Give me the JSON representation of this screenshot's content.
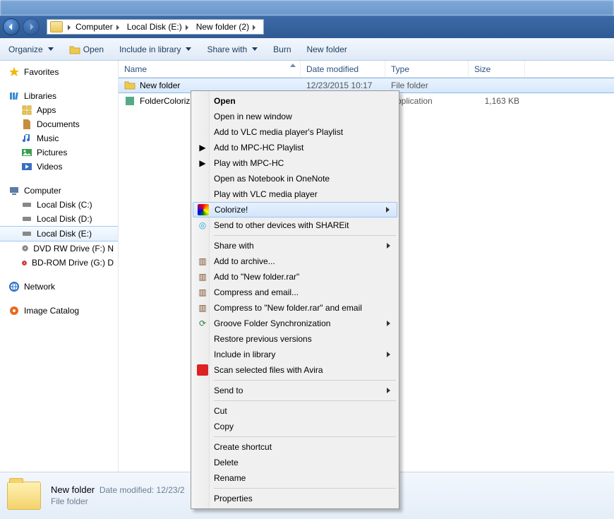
{
  "breadcrumb": {
    "parts": [
      "Computer",
      "Local Disk (E:)",
      "New folder (2)"
    ]
  },
  "toolbar": {
    "organize": "Organize",
    "open": "Open",
    "include": "Include in library",
    "share": "Share with",
    "burn": "Burn",
    "newfolder": "New folder"
  },
  "nav": {
    "favorites": "Favorites",
    "libraries": "Libraries",
    "apps": "Apps",
    "documents": "Documents",
    "music": "Music",
    "pictures": "Pictures",
    "videos": "Videos",
    "computer": "Computer",
    "drive_c": "Local Disk (C:)",
    "drive_d": "Local Disk (D:)",
    "drive_e": "Local Disk (E:)",
    "drive_f": "DVD RW Drive (F:)  N",
    "drive_g": "BD-ROM Drive (G:) D",
    "network": "Network",
    "imagecatalog": "Image Catalog"
  },
  "columns": {
    "name": "Name",
    "date": "Date modified",
    "type": "Type",
    "size": "Size"
  },
  "rows": [
    {
      "name": "New folder",
      "date": "12/23/2015 10:17",
      "type": "File folder",
      "size": ""
    },
    {
      "name": "FolderColoriz",
      "date": "",
      "type": "Application",
      "size": "1,163 KB"
    }
  ],
  "ctx": {
    "open": "Open",
    "open_new_win": "Open in new window",
    "add_vlc_pl": "Add to VLC media player's Playlist",
    "add_mpc_pl": "Add to MPC-HC Playlist",
    "play_mpc": "Play with MPC-HC",
    "open_onenote": "Open as Notebook in OneNote",
    "play_vlc": "Play with VLC media player",
    "colorize": "Colorize!",
    "shareit": "Send to other devices with SHAREit",
    "share_with": "Share with",
    "add_archive": "Add to archive...",
    "add_rar": "Add to \"New folder.rar\"",
    "compress_email": "Compress and email...",
    "compress_rar_email": "Compress to \"New folder.rar\" and email",
    "groove": "Groove Folder Synchronization",
    "restore_prev": "Restore previous versions",
    "include_lib": "Include in library",
    "scan_avira": "Scan selected files with Avira",
    "send_to": "Send to",
    "cut": "Cut",
    "copy": "Copy",
    "create_shortcut": "Create shortcut",
    "delete": "Delete",
    "rename": "Rename",
    "properties": "Properties"
  },
  "details": {
    "name": "New folder",
    "date_label": "Date modified:",
    "date": "12/23/2",
    "type": "File folder"
  }
}
